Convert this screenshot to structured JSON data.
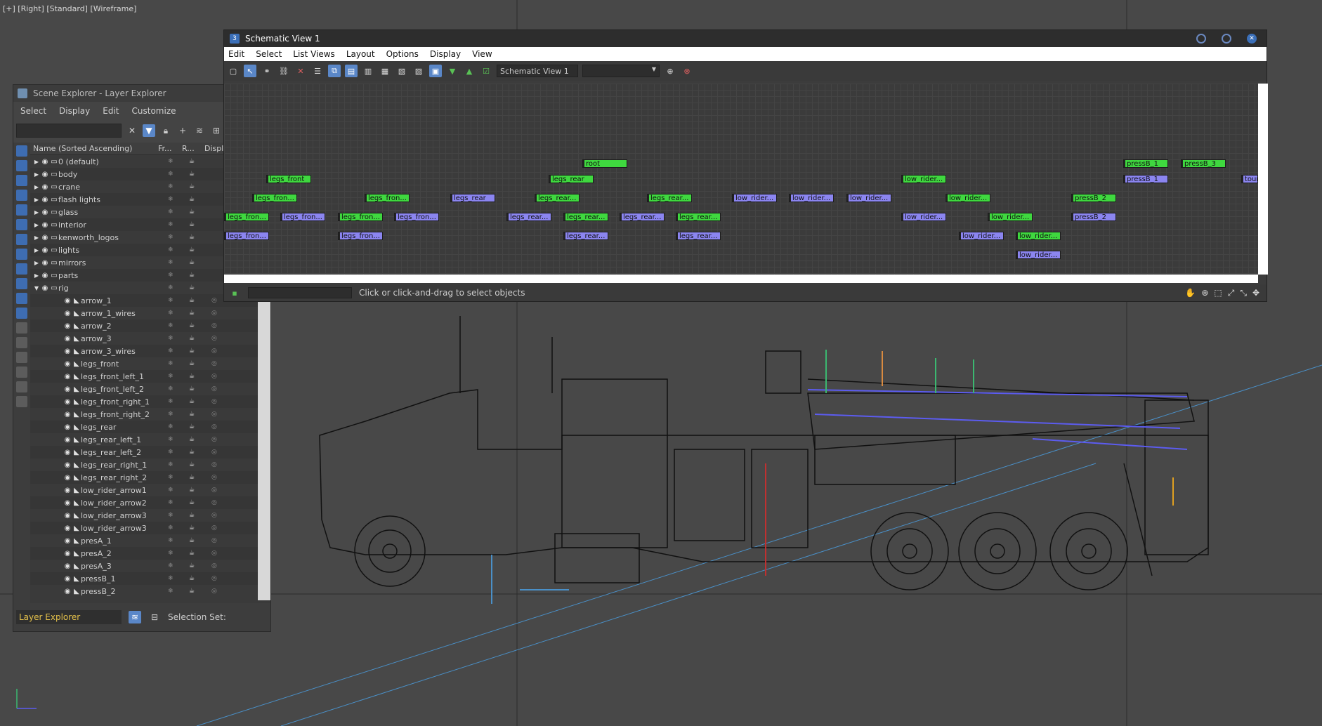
{
  "viewport": {
    "label": "[+] [Right] [Standard] [Wireframe]"
  },
  "scene_explorer": {
    "title": "Scene Explorer - Layer Explorer",
    "menu": [
      "Select",
      "Display",
      "Edit",
      "Customize"
    ],
    "columns": [
      "Name (Sorted Ascending)",
      "Fr...",
      "R...",
      "Displa"
    ],
    "rows": [
      {
        "name": "0 (default)",
        "level": 0,
        "expander": "▶"
      },
      {
        "name": "body",
        "level": 0,
        "expander": "▶"
      },
      {
        "name": "crane",
        "level": 0,
        "expander": "▶"
      },
      {
        "name": "flash lights",
        "level": 0,
        "expander": "▶"
      },
      {
        "name": "glass",
        "level": 0,
        "expander": "▶"
      },
      {
        "name": "interior",
        "level": 0,
        "expander": "▶"
      },
      {
        "name": "kenworth_logos",
        "level": 0,
        "expander": "▶"
      },
      {
        "name": "lights",
        "level": 0,
        "expander": "▶"
      },
      {
        "name": "mirrors",
        "level": 0,
        "expander": "▶"
      },
      {
        "name": "parts",
        "level": 0,
        "expander": "▶"
      },
      {
        "name": "rig",
        "level": 0,
        "expander": "▼"
      },
      {
        "name": "arrow_1",
        "level": 1,
        "expander": ""
      },
      {
        "name": "arrow_1_wires",
        "level": 1,
        "expander": ""
      },
      {
        "name": "arrow_2",
        "level": 1,
        "expander": ""
      },
      {
        "name": "arrow_3",
        "level": 1,
        "expander": ""
      },
      {
        "name": "arrow_3_wires",
        "level": 1,
        "expander": ""
      },
      {
        "name": "legs_front",
        "level": 1,
        "expander": ""
      },
      {
        "name": "legs_front_left_1",
        "level": 1,
        "expander": ""
      },
      {
        "name": "legs_front_left_2",
        "level": 1,
        "expander": ""
      },
      {
        "name": "legs_front_right_1",
        "level": 1,
        "expander": ""
      },
      {
        "name": "legs_front_right_2",
        "level": 1,
        "expander": ""
      },
      {
        "name": "legs_rear",
        "level": 1,
        "expander": ""
      },
      {
        "name": "legs_rear_left_1",
        "level": 1,
        "expander": ""
      },
      {
        "name": "legs_rear_left_2",
        "level": 1,
        "expander": ""
      },
      {
        "name": "legs_rear_right_1",
        "level": 1,
        "expander": ""
      },
      {
        "name": "legs_rear_right_2",
        "level": 1,
        "expander": ""
      },
      {
        "name": "low_rider_arrow1",
        "level": 1,
        "expander": ""
      },
      {
        "name": "low_rider_arrow2",
        "level": 1,
        "expander": ""
      },
      {
        "name": "low_rider_arrow3",
        "level": 1,
        "expander": ""
      },
      {
        "name": "low_rider_arrow3",
        "level": 1,
        "expander": ""
      },
      {
        "name": "presA_1",
        "level": 1,
        "expander": ""
      },
      {
        "name": "presA_2",
        "level": 1,
        "expander": ""
      },
      {
        "name": "presA_3",
        "level": 1,
        "expander": ""
      },
      {
        "name": "pressB_1",
        "level": 1,
        "expander": ""
      },
      {
        "name": "pressB_2",
        "level": 1,
        "expander": ""
      }
    ],
    "footer": {
      "explorer_type": "Layer Explorer",
      "selection_set_label": "Selection Set:"
    }
  },
  "schematic": {
    "title": "Schematic View 1",
    "menu": [
      "Edit",
      "Select",
      "List Views",
      "Layout",
      "Options",
      "Display",
      "View"
    ],
    "name_field": "Schematic View 1",
    "status_text": "Click or click-and-drag to select objects",
    "nodes": [
      {
        "label": "root",
        "color": "green"
      },
      {
        "label": "pressB_1",
        "color": "green"
      },
      {
        "label": "pressB_3",
        "color": "green"
      },
      {
        "label": "legs_front",
        "color": "green"
      },
      {
        "label": "legs_rear",
        "color": "green"
      },
      {
        "label": "low_rider...",
        "color": "green"
      },
      {
        "label": "pressB_1",
        "color": "blue"
      },
      {
        "label": "tour",
        "color": "blue"
      },
      {
        "label": "legs_fron...",
        "color": "green"
      },
      {
        "label": "legs_fron...",
        "color": "green"
      },
      {
        "label": "legs_rear",
        "color": "blue"
      },
      {
        "label": "legs_rear...",
        "color": "green"
      },
      {
        "label": "legs_rear...",
        "color": "green"
      },
      {
        "label": "low_rider...",
        "color": "blue"
      },
      {
        "label": "low_rider...",
        "color": "blue"
      },
      {
        "label": "low_rider...",
        "color": "blue"
      },
      {
        "label": "low_rider...",
        "color": "green"
      },
      {
        "label": "pressB_2",
        "color": "green"
      },
      {
        "label": "legs_fron...",
        "color": "green"
      },
      {
        "label": "legs_fron...",
        "color": "blue"
      },
      {
        "label": "legs_fron...",
        "color": "green"
      },
      {
        "label": "legs_fron...",
        "color": "blue"
      },
      {
        "label": "legs_rear...",
        "color": "blue"
      },
      {
        "label": "legs_rear...",
        "color": "green"
      },
      {
        "label": "legs_rear...",
        "color": "blue"
      },
      {
        "label": "legs_rear...",
        "color": "green"
      },
      {
        "label": "low_rider...",
        "color": "blue"
      },
      {
        "label": "low_rider...",
        "color": "green"
      },
      {
        "label": "pressB_2",
        "color": "blue"
      },
      {
        "label": "legs_fron...",
        "color": "blue"
      },
      {
        "label": "legs_fron...",
        "color": "blue"
      },
      {
        "label": "legs_rear...",
        "color": "blue"
      },
      {
        "label": "legs_rear...",
        "color": "blue"
      },
      {
        "label": "low_rider...",
        "color": "blue"
      },
      {
        "label": "low_rider...",
        "color": "green"
      },
      {
        "label": "low_rider...",
        "color": "blue"
      }
    ]
  },
  "colors": {
    "node_green": "#3fd83f",
    "node_blue": "#8b85f0",
    "accent": "#5a87c8",
    "layer_explorer_text": "#e4c14b"
  }
}
